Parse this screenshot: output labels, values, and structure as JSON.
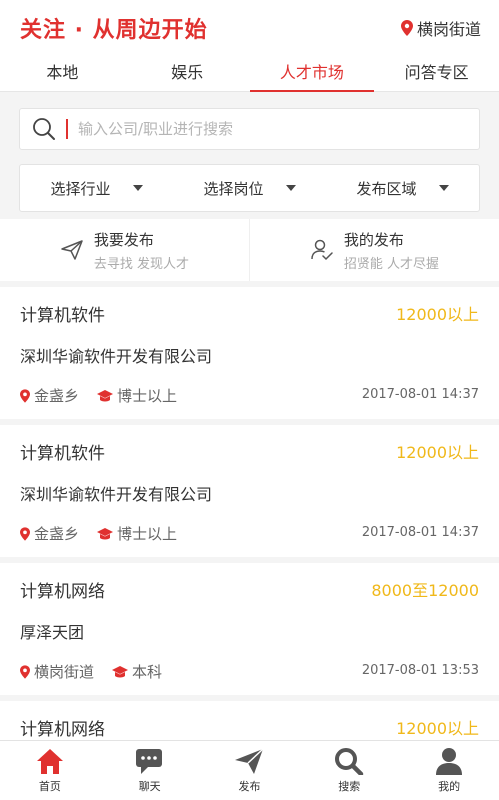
{
  "header": {
    "brand": "关注 · 从周边开始",
    "location": "横岗街道"
  },
  "tabs": [
    {
      "label": "本地",
      "active": false
    },
    {
      "label": "娱乐",
      "active": false
    },
    {
      "label": "人才市场",
      "active": true
    },
    {
      "label": "问答专区",
      "active": false
    }
  ],
  "search": {
    "placeholder": "输入公司/职业进行搜索",
    "value": ""
  },
  "filters": [
    "选择行业",
    "选择岗位",
    "发布区域"
  ],
  "publish": [
    {
      "title": "我要发布",
      "sub": "去寻找 发现人才",
      "icon": "send-icon"
    },
    {
      "title": "我的发布",
      "sub": "招贤能 人才尽握",
      "icon": "user-check-icon"
    }
  ],
  "jobs": [
    {
      "title": "计算机软件",
      "salary": "12000以上",
      "company": "深圳华谕软件开发有限公司",
      "location": "金盏乡",
      "education": "博士以上",
      "time": "2017-08-01 14:37"
    },
    {
      "title": "计算机软件",
      "salary": "12000以上",
      "company": "深圳华谕软件开发有限公司",
      "location": "金盏乡",
      "education": "博士以上",
      "time": "2017-08-01 14:37"
    },
    {
      "title": "计算机网络",
      "salary": "8000至12000",
      "company": "厚泽天团",
      "location": "横岗街道",
      "education": "本科",
      "time": "2017-08-01 13:53"
    },
    {
      "title": "计算机网络",
      "salary": "12000以上",
      "company": "",
      "location": "",
      "education": "",
      "time": ""
    }
  ],
  "tabbar": [
    {
      "label": "首页",
      "icon": "home-icon",
      "active": true
    },
    {
      "label": "聊天",
      "icon": "chat-icon",
      "active": false
    },
    {
      "label": "发布",
      "icon": "send-icon",
      "active": false
    },
    {
      "label": "搜索",
      "icon": "search-icon",
      "active": false
    },
    {
      "label": "我的",
      "icon": "profile-icon",
      "active": false
    }
  ],
  "colors": {
    "accent": "#e0312f",
    "salary": "#f0b81a",
    "icon_gray": "#555555"
  }
}
